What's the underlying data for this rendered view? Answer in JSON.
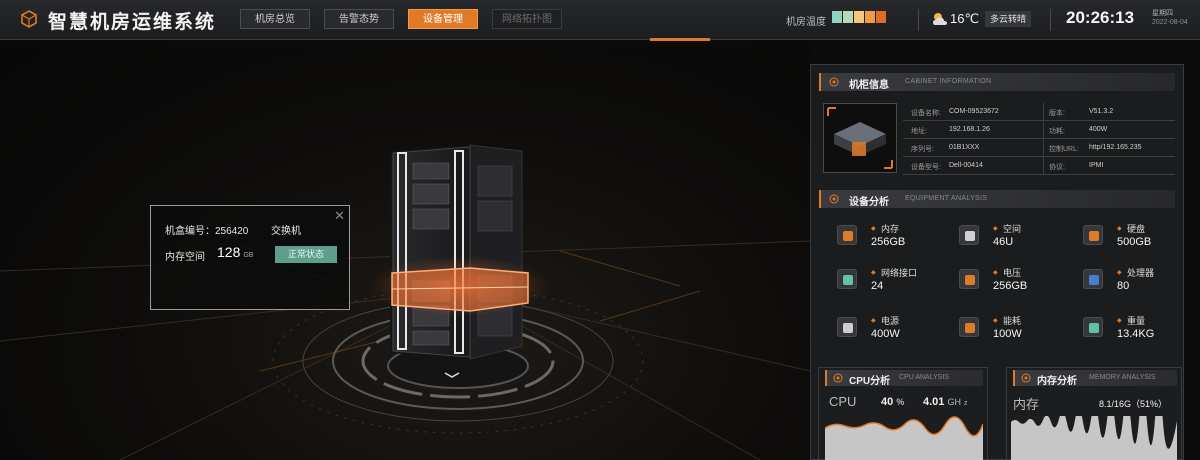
{
  "app": {
    "title": "智慧机房运维系统"
  },
  "nav": {
    "tabs": [
      "机房总览",
      "告警态势",
      "设备管理",
      "网络拓扑图"
    ],
    "active_index": 2
  },
  "header": {
    "temp_label": "机房温度",
    "temp_scale_colors": [
      "#8fd3c0",
      "#b7d9b4",
      "#f4c77a",
      "#f09a48",
      "#e06b26"
    ],
    "weather_icon": "partly-cloudy-icon",
    "temperature": "16℃",
    "weather": "多云转晴",
    "time": "20:26:13",
    "weekday": "星期四",
    "date": "2022-08-04"
  },
  "popup": {
    "id_label": "机盒编号：",
    "id_value": "256420",
    "type": "交换机",
    "memory_label": "内存空间",
    "memory_value": "128",
    "memory_unit": "GB",
    "status": "正常状态"
  },
  "cabinet_info": {
    "title": "机柜信息",
    "subtitle": "CABINET INFORMATION",
    "rows": [
      {
        "k1": "设备名称:",
        "v1": "COM-09523672",
        "k2": "版本:",
        "v2": "V51.3.2"
      },
      {
        "k1": "地址:",
        "v1": "192.168.1.26",
        "k2": "功耗:",
        "v2": "400W"
      },
      {
        "k1": "序列号:",
        "v1": "01B1XXX",
        "k2": "控制URL:",
        "v2": "http/192.165.235"
      },
      {
        "k1": "设备型号:",
        "v1": "Dell-00414",
        "k2": "协议:",
        "v2": "IPMI"
      }
    ]
  },
  "equipment": {
    "title": "设备分析",
    "subtitle": "EQUIPMENT ANALYSIS",
    "metrics": [
      {
        "label": "内存",
        "value": "256GB",
        "icon": "memory-icon",
        "color": "#e07a26"
      },
      {
        "label": "空间",
        "value": "46U",
        "icon": "space-cube-icon",
        "color": "#cfcfcf"
      },
      {
        "label": "硬盘",
        "value": "500GB",
        "icon": "hard-disk-icon",
        "color": "#e07a26"
      },
      {
        "label": "网络接口",
        "value": "24",
        "icon": "network-port-icon",
        "color": "#5ec4a8"
      },
      {
        "label": "电压",
        "value": "256GB",
        "icon": "voltage-icon",
        "color": "#e07a26"
      },
      {
        "label": "处理器",
        "value": "80",
        "icon": "processor-icon",
        "color": "#4a7bd0"
      },
      {
        "label": "电源",
        "value": "400W",
        "icon": "power-supply-icon",
        "color": "#cfcfcf"
      },
      {
        "label": "能耗",
        "value": "100W",
        "icon": "energy-icon",
        "color": "#e07a26"
      },
      {
        "label": "重量",
        "value": "13.4KG",
        "icon": "weight-icon",
        "color": "#5ec4a8"
      }
    ]
  },
  "cpu": {
    "title": "CPU分析",
    "subtitle": "CPU ANALYSIS",
    "label": "CPU",
    "percent": "40",
    "percent_sign": "%",
    "freq": "4.01",
    "freq_unit": "GH",
    "freq_suffix": "z"
  },
  "memory": {
    "title": "内存分析",
    "subtitle": "MEMORY ANALYSIS",
    "label": "内存",
    "usage": "8.1/16G（51%）"
  }
}
